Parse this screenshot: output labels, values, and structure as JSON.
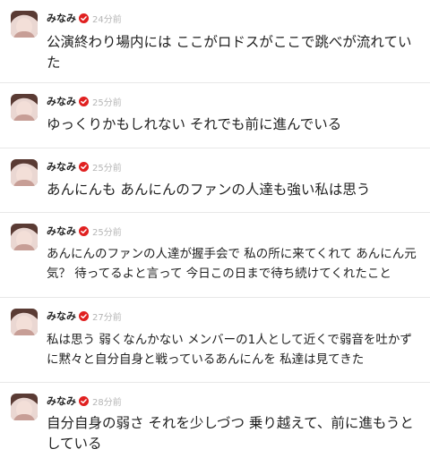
{
  "colors": {
    "verified_badge": "#e02020",
    "timestamp": "#b5b5b5",
    "divider": "#e8e8e8",
    "text": "#1f1f1f"
  },
  "posts": [
    {
      "author": "みなみ",
      "time": "24分前",
      "text": "公演終わり場内には ここがロドスがここで跳べが流れていた"
    },
    {
      "author": "みなみ",
      "time": "25分前",
      "text": "ゆっくりかもしれない それでも前に進んでいる"
    },
    {
      "author": "みなみ",
      "time": "25分前",
      "text": "あんにんも あんにんのファンの人達も強い私は思う"
    },
    {
      "author": "みなみ",
      "time": "25分前",
      "text": "あんにんのファンの人達が握手会で 私の所に来てくれて あんにん元気？ 待ってるよと言って 今日この日まで待ち続けてくれたこと"
    },
    {
      "author": "みなみ",
      "time": "27分前",
      "text": "私は思う 弱くなんかない メンバーの1人として近くで弱音を吐かずに黙々と自分自身と戦っているあんにんを 私達は見てきた"
    },
    {
      "author": "みなみ",
      "time": "28分前",
      "text": "自分自身の弱さ それを少しづつ 乗り越えて、前に進もうとしている"
    }
  ]
}
